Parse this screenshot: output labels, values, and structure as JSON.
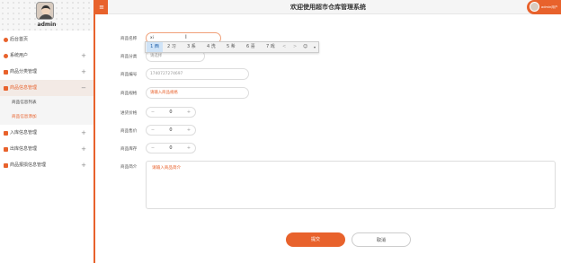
{
  "header": {
    "title": "欢迎使用超市仓库管理系统",
    "menu_icon": "≡",
    "user_text": "admin用户"
  },
  "sidebar": {
    "username": "admin",
    "items": [
      {
        "label": "后台首页",
        "icon": "home-icon",
        "toggle": ""
      },
      {
        "label": "系统用户",
        "icon": "user-icon",
        "toggle": "+"
      },
      {
        "label": "商品分类管理",
        "icon": "grid-icon",
        "toggle": "+"
      },
      {
        "label": "商品信息管理",
        "icon": "grid-icon",
        "toggle": "−"
      },
      {
        "label": "入库信息管理",
        "icon": "grid-icon",
        "toggle": "+"
      },
      {
        "label": "出库信息管理",
        "icon": "grid-icon",
        "toggle": "+"
      },
      {
        "label": "商品报损信息管理",
        "icon": "grid-icon",
        "toggle": "+"
      }
    ],
    "subitems": [
      {
        "label": "商品信息列表"
      },
      {
        "label": "商品信息添加"
      }
    ]
  },
  "form": {
    "name_label": "商品名称",
    "name_value": "xi",
    "category_label": "商品分类",
    "category_value": "请选择",
    "code_label": "商品编号",
    "code_value": "1740727274697",
    "spec_label": "商品规格",
    "spec_placeholder": "请输入商品规格",
    "purchase_label": "进货价格",
    "purchase_value": "0",
    "sale_label": "商品售价",
    "sale_value": "0",
    "stock_label": "商品库存",
    "stock_value": "0",
    "intro_label": "商品简介",
    "intro_placeholder": "请输入商品简介",
    "minus": "−",
    "plus": "+",
    "submit_label": "提交",
    "cancel_label": "取消"
  },
  "ime": {
    "candidates": [
      "1 西",
      "2 习",
      "3 系",
      "4 洗",
      "5 希",
      "6 喜",
      "7 戏"
    ],
    "controls": [
      "<",
      ">",
      "☺",
      "▾"
    ]
  },
  "colors": {
    "accent": "#e8622c"
  }
}
